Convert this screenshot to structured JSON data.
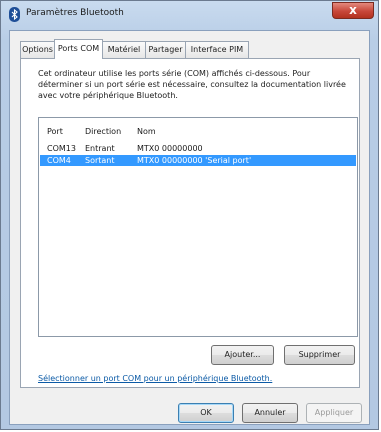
{
  "window": {
    "title": "Paramètres Bluetooth",
    "close_glyph": "x"
  },
  "tabs": [
    {
      "label": "Options"
    },
    {
      "label": "Ports COM"
    },
    {
      "label": "Matériel"
    },
    {
      "label": "Partager"
    },
    {
      "label": "Interface PIM"
    }
  ],
  "description": "Cet ordinateur utilise les ports série (COM) affichés ci-dessous. Pour déterminer si un port série est nécessaire, consultez la documentation livrée avec votre périphérique Bluetooth.",
  "table": {
    "columns": [
      "Port",
      "Direction",
      "Nom"
    ],
    "rows": [
      {
        "port": "COM13",
        "direction": "Entrant",
        "name": "MTX0 00000000"
      },
      {
        "port": "COM4",
        "direction": "Sortant",
        "name": "MTX0 00000000 'Serial port'",
        "selected": true
      }
    ]
  },
  "buttons": {
    "add": "Ajouter...",
    "remove": "Supprimer",
    "ok": "OK",
    "cancel": "Annuler",
    "apply": "Appliquer"
  },
  "link_text": "Sélectionner un port COM pour un périphérique Bluetooth.",
  "colors": {
    "selection": "#3399ff",
    "link": "#0b5aa6",
    "close": "#c8473a"
  }
}
